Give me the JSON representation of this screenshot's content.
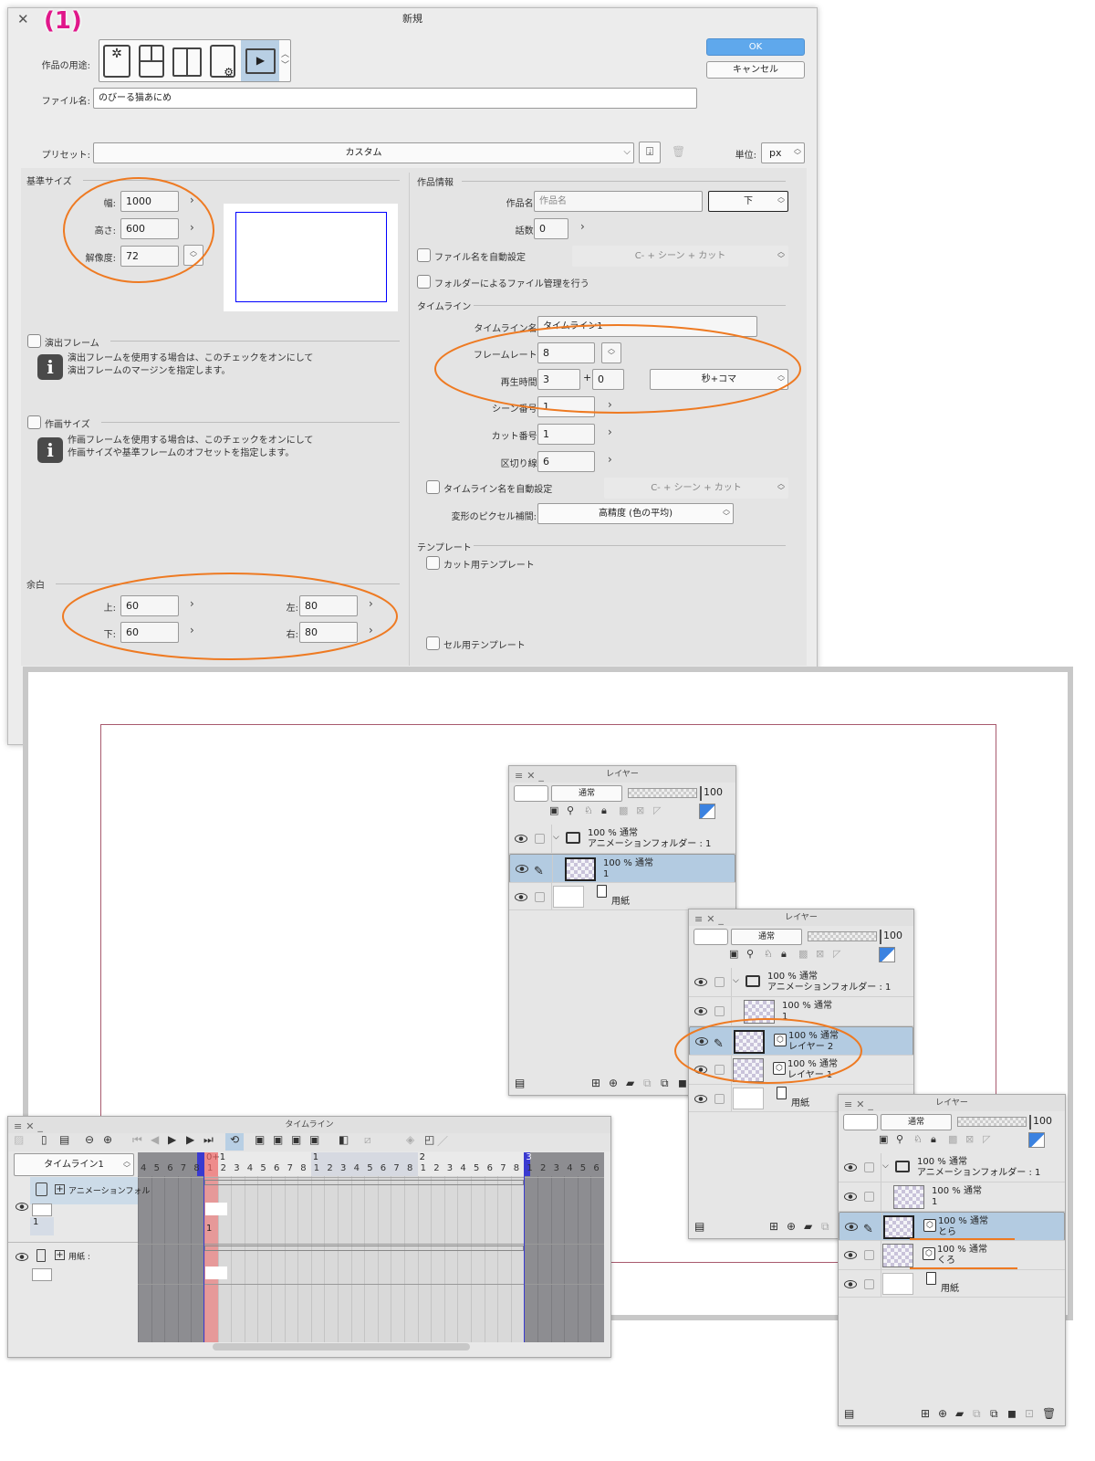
{
  "step_marker": "(1)",
  "dialog": {
    "title": "新規",
    "usage_label": "作品の用途:",
    "usage_icons": [
      "illustration-icon",
      "comic-icon",
      "book-icon",
      "comic-settings-icon",
      "animation-icon"
    ],
    "ok": "OK",
    "cancel": "キャンセル",
    "filename_label": "ファイル名:",
    "filename_value": "のびーる猫あにめ",
    "preset_label": "プリセット:",
    "preset_value": "カスタム",
    "unit_label": "単位:",
    "unit_value": "px",
    "base_size": {
      "title": "基準サイズ",
      "width_label": "幅:",
      "width": "1000",
      "height_label": "高さ:",
      "height": "600",
      "res_label": "解像度:",
      "res": "72"
    },
    "direction_frame": {
      "label": "演出フレーム",
      "note1": "演出フレームを使用する場合は、このチェックをオンにして",
      "note2": "演出フレームのマージンを指定します。"
    },
    "drawing_size": {
      "label": "作画サイズ",
      "note1": "作画フレームを使用する場合は、このチェックをオンにして",
      "note2": "作画サイズや基準フレームのオフセットを指定します。"
    },
    "margin": {
      "title": "余白",
      "top_label": "上:",
      "top": "60",
      "bottom_label": "下:",
      "bottom": "60",
      "left_label": "左:",
      "left": "80",
      "right_label": "右:",
      "right": "80"
    },
    "work_info": {
      "title": "作品情報",
      "name_label": "作品名:",
      "name_placeholder": "作品名",
      "name_pos": "下",
      "episode_label": "話数:",
      "episode": "0",
      "auto_filename": "ファイル名を自動設定",
      "auto_filename_format": "C- + シーン + カット",
      "folder_manage": "フォルダーによるファイル管理を行う"
    },
    "timeline": {
      "title": "タイムライン",
      "name_label": "タイムライン名:",
      "name": "タイムライン1",
      "fps_label": "フレームレート:",
      "fps": "8",
      "duration_label": "再生時間:",
      "duration_sec": "3",
      "plus": "+",
      "duration_frames": "0",
      "duration_unit": "秒+コマ",
      "scene_label": "シーン番号:",
      "scene": "1",
      "cut_label": "カット番号:",
      "cut": "1",
      "divider_label": "区切り線:",
      "divider": "6",
      "auto_name": "タイムライン名を自動設定",
      "auto_name_format": "C- + シーン + カット",
      "interp_label": "変形のピクセル補間:",
      "interp": "高精度 (色の平均)"
    },
    "template": {
      "title": "テンプレート",
      "cut_template": "カット用テンプレート",
      "cel_template": "セル用テンプレート"
    }
  },
  "layer_panels": [
    {
      "title": "レイヤー",
      "blend": "通常",
      "opacity": "100",
      "rows": [
        {
          "type": "folder",
          "line1": "100 % 通常",
          "line2": "アニメーションフォルダー : 1"
        },
        {
          "type": "layer",
          "line1": "100 % 通常",
          "line2": "1",
          "selected": true,
          "cel": false
        },
        {
          "type": "paper",
          "line1": "用紙"
        }
      ]
    },
    {
      "title": "レイヤー",
      "blend": "通常",
      "opacity": "100",
      "rows": [
        {
          "type": "folder",
          "line1": "100 % 通常",
          "line2": "アニメーションフォルダー : 1"
        },
        {
          "type": "layer",
          "line1": "100 % 通常",
          "line2": "1",
          "selected": false,
          "cel": false
        },
        {
          "type": "layer",
          "line1": "100 % 通常",
          "line2": "レイヤー 2",
          "selected": true,
          "cel": true
        },
        {
          "type": "layer",
          "line1": "100 % 通常",
          "line2": "レイヤー 1",
          "selected": false,
          "cel": true
        },
        {
          "type": "paper",
          "line1": "用紙"
        }
      ]
    },
    {
      "title": "レイヤー",
      "blend": "通常",
      "opacity": "100",
      "rows": [
        {
          "type": "folder",
          "line1": "100 % 通常",
          "line2": "アニメーションフォルダー : 1"
        },
        {
          "type": "layer",
          "line1": "100 % 通常",
          "line2": "1",
          "selected": false,
          "cel": false
        },
        {
          "type": "layer",
          "line1": "100 % 通常",
          "line2": "とら",
          "selected": true,
          "cel": true
        },
        {
          "type": "layer",
          "line1": "100 % 通常",
          "line2": "くろ",
          "selected": false,
          "cel": true
        },
        {
          "type": "paper",
          "line1": "用紙"
        }
      ]
    }
  ],
  "timeline_panel": {
    "title": "タイムライン",
    "selector": "タイムライン1",
    "ruler_frames": [
      "4",
      "5",
      "6",
      "7",
      "8",
      "1",
      "2",
      "3",
      "4",
      "5",
      "6",
      "7",
      "8",
      "1",
      "2",
      "3",
      "4",
      "5",
      "6",
      "7",
      "8",
      "1",
      "2",
      "3",
      "4",
      "5",
      "6",
      "7",
      "8",
      "1",
      "2",
      "3",
      "4",
      "5",
      "6"
    ],
    "second_markers": [
      "0+1",
      "1",
      "2",
      "3"
    ],
    "tracks": [
      {
        "name": "アニメーションフォル",
        "cel": "1",
        "frame_label": "1"
      },
      {
        "name": "用紙 :"
      }
    ]
  },
  "colors": {
    "accent": "#5fa8ec",
    "annotation": "#ee7a22",
    "marker": "#e0178a",
    "selected": "#b3cbe1"
  }
}
